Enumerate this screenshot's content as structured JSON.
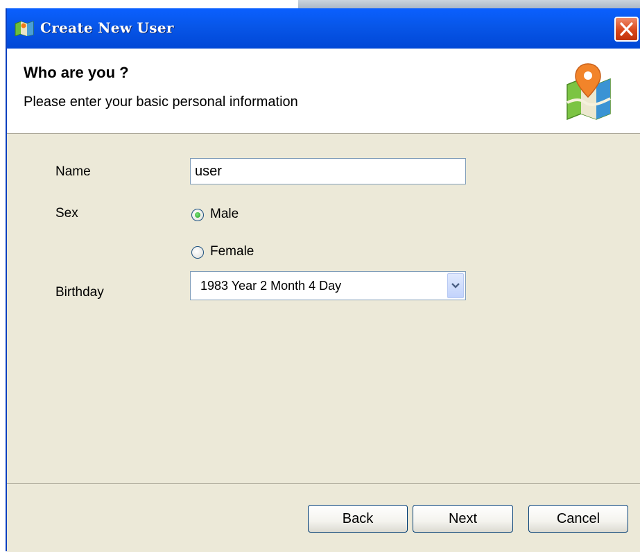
{
  "window": {
    "title": "Create New User",
    "close_glyph": "×"
  },
  "header": {
    "title": "Who are you ?",
    "subtitle": "Please enter your basic personal information",
    "icon": "map-pin-icon"
  },
  "form": {
    "name_label": "Name",
    "name_value": "user",
    "sex_label": "Sex",
    "sex_options": [
      {
        "label": "Male",
        "selected": true
      },
      {
        "label": "Female",
        "selected": false
      }
    ],
    "birthday_label": "Birthday",
    "birthday_value": "1983 Year 2 Month 4 Day"
  },
  "buttons": {
    "back": "Back",
    "next": "Next",
    "cancel": "Cancel"
  },
  "colors": {
    "titlebar": "#0a60ff",
    "dialog_bg": "#ece9d8",
    "close_button": "#d9471a",
    "radio_selected": "#21a121"
  }
}
